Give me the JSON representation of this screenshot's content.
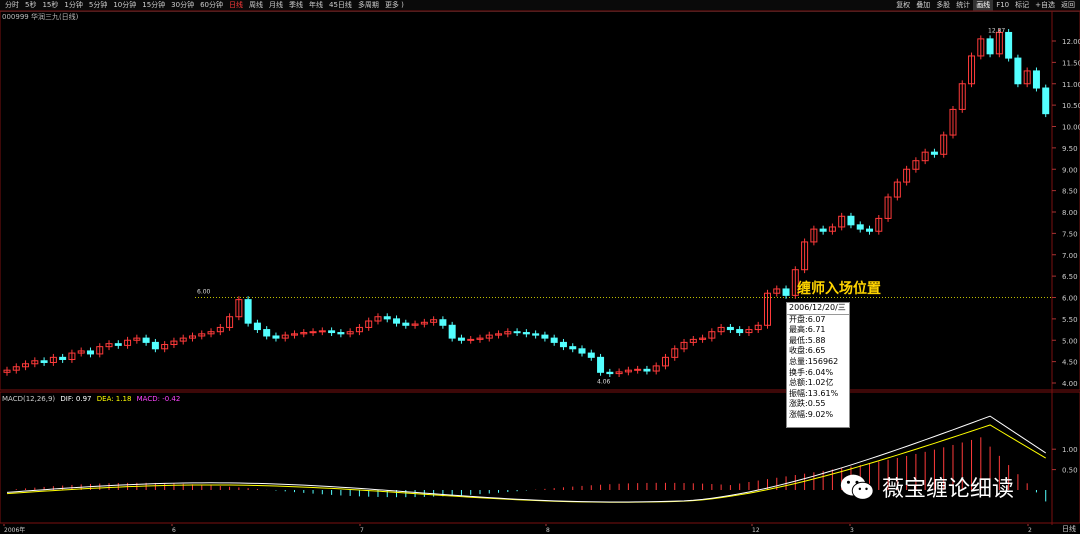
{
  "toolbar": {
    "left_items": [
      "分时",
      "5秒",
      "15秒",
      "1分钟",
      "5分钟",
      "10分钟",
      "15分钟",
      "30分钟",
      "60分钟",
      "日线",
      "周线",
      "月线",
      "季线",
      "年线",
      "45日线",
      "多周期",
      "更多 )"
    ],
    "active_period": "日线",
    "right_items": [
      "复权",
      "叠加",
      "多股",
      "统计",
      "画线",
      "F10",
      "标记",
      "+自选",
      "返回"
    ],
    "active_right": "画线"
  },
  "security": {
    "info": "000999 华润三九(日线)"
  },
  "annotation": {
    "text": "缠师入场位置"
  },
  "popup": {
    "date": "2006/12/20/三",
    "rows": [
      "开盘:6.07",
      "最高:6.71",
      "最低:5.88",
      "收盘:6.65",
      "总量:156962",
      "换手:6.04%",
      "总额:1.02亿",
      "振幅:13.61%",
      "涨跌:0.55",
      "涨幅:9.02%"
    ]
  },
  "macd": {
    "title": "MACD(12,26,9)",
    "dif_label": "DIF: 0.97",
    "dea_label": "DEA: 1.18",
    "macd_label": "MACD: -0.42"
  },
  "labels": {
    "high_left": "6.00",
    "low_label": "4.06",
    "high_right": "12.87"
  },
  "price_axis": [
    "12.00",
    "11.50",
    "11.00",
    "10.50",
    "10.00",
    "9.50",
    "9.00",
    "8.50",
    "8.00",
    "7.50",
    "7.00",
    "6.50",
    "6.00",
    "5.50",
    "5.00",
    "4.50",
    "4.00"
  ],
  "macd_axis": [
    "1.00",
    "0.50"
  ],
  "time_axis": [
    "2006年",
    "6",
    "7",
    "8",
    "12",
    "3",
    "2"
  ],
  "watermark": {
    "text": "薇宝缠论细读"
  },
  "bottom_label": "日线",
  "colors": {
    "up": "#ff3b3b",
    "down": "#54ffff",
    "dif": "#ffffff",
    "dea": "#ffff00",
    "macd": "#ff44ff",
    "dotline": "#ffff00"
  }
}
